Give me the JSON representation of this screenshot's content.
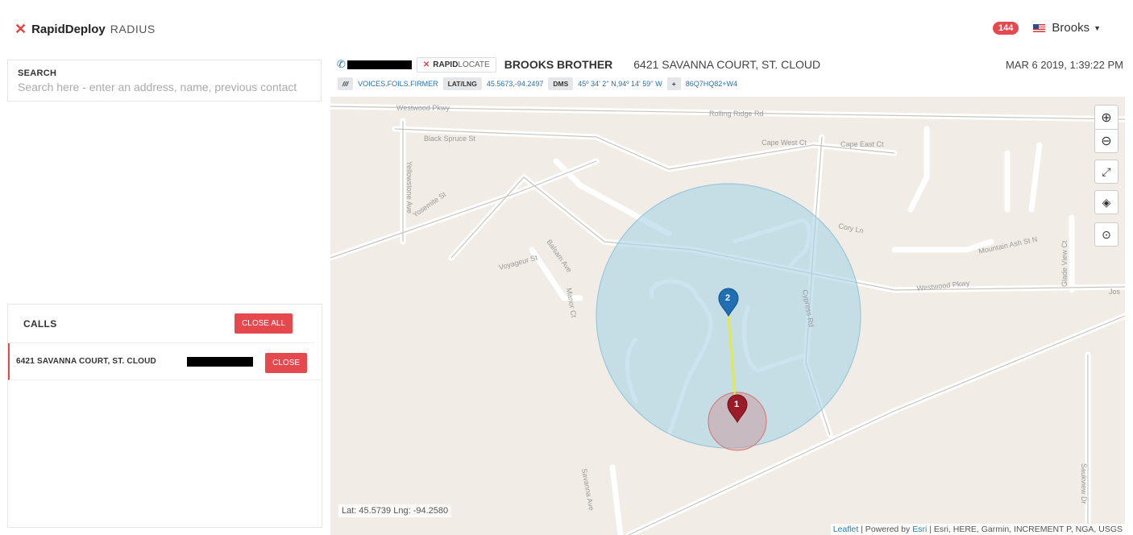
{
  "brand": {
    "name": "RapidDeploy",
    "product": "RADIUS"
  },
  "user": {
    "badge_count": "144",
    "name": "Brooks"
  },
  "search": {
    "title": "SEARCH",
    "placeholder": "Search here - enter an address, name, previous contact"
  },
  "calls": {
    "title": "CALLS",
    "close_all_label": "CLOSE ALL",
    "items": [
      {
        "address": "6421 SAVANNA COURT, ST. CLOUD",
        "close_label": "CLOSE"
      }
    ]
  },
  "incident": {
    "rapidlocate_bold": "RAPID",
    "rapidlocate_light": "LOCATE",
    "caller": "BROOKS BROTHER",
    "address": "6421 SAVANNA COURT, ST. CLOUD",
    "datetime": "MAR 6 2019, 1:39:22 PM",
    "w3w_chip": "///",
    "w3w_value": "VOICES.FOILS.FIRMER",
    "latlng_chip": "LAT/LNG",
    "latlng_value": "45.5673,-94.2497",
    "dms_chip": "DMS",
    "dms_value": "45º 34' 2'' N,94º 14' 59'' W",
    "plus_chip": "+",
    "plus_value": "86Q7HQ82+W4"
  },
  "map": {
    "coords_readout": "Lat: 45.5739 Lng: -94.2580",
    "attribution_leaflet": "Leaflet",
    "attribution_sep": " | Powered by ",
    "attribution_esri": "Esri",
    "attribution_rest": " | Esri, HERE, Garmin, INCREMENT P, NGA, USGS",
    "pin1_label": "1",
    "pin2_label": "2",
    "streets": {
      "westwood_pkwy_1": "Westwood Pkwy",
      "rolling_ridge": "Rolling Ridge Rd",
      "black_spruce": "Black Spruce St",
      "cape_west": "Cape West Ct",
      "cape_east": "Cape East Ct",
      "yellowstone": "Yellowstone Ave",
      "yosemite": "Yosemite St",
      "cory": "Cory Ln",
      "mountain_ash": "Mountain Ash St N",
      "glade_view": "Glade View Ct",
      "voyageur": "Voyageur St",
      "balsam": "Balsam Ave",
      "manor": "Manor Ct",
      "cypress": "Cypress Rd",
      "westwood_pkwy_2": "Westwood Pkwy",
      "savanna": "Savanna Ave",
      "sauk_view": "Saukview Dr",
      "jos": "Jos"
    },
    "colors": {
      "outer_circle": "#a9d3e6",
      "inner_circle": "#c8a3a8",
      "pin1": "#9b1c27",
      "pin2": "#1f6fb2",
      "line": "#f0f000"
    }
  }
}
